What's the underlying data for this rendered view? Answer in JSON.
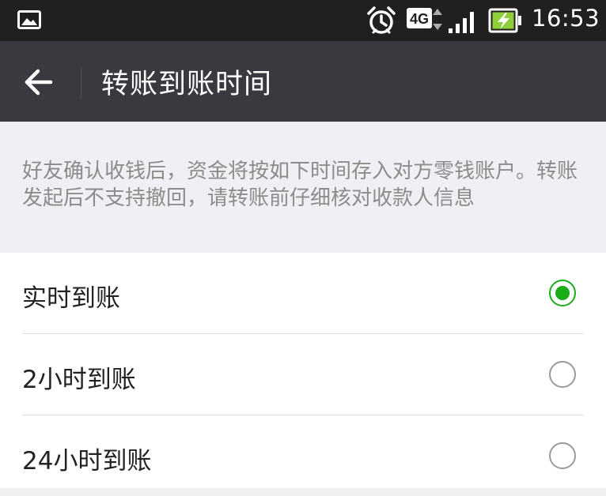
{
  "status_bar": {
    "network_label": "4G",
    "time": "16:53",
    "icons": [
      "image-notification-icon",
      "alarm-icon",
      "network-4g-icon",
      "signal-icon",
      "battery-charging-icon"
    ]
  },
  "header": {
    "back_icon": "back-arrow-icon",
    "title": "转账到账时间"
  },
  "notice": {
    "text": "好友确认收钱后，资金将按如下时间存入对方零钱账户。转账发起后不支持撤回，请转账前仔细核对收款人信息"
  },
  "options": [
    {
      "label": "实时到账",
      "selected": true
    },
    {
      "label": "2小时到账",
      "selected": false
    },
    {
      "label": "24小时到账",
      "selected": false
    }
  ],
  "colors": {
    "status_bar": "#202020",
    "app_bar": "#393a3f",
    "notice_background": "#efeff4",
    "notice_text": "#8c8c8c",
    "accent_green": "#1aad19"
  }
}
